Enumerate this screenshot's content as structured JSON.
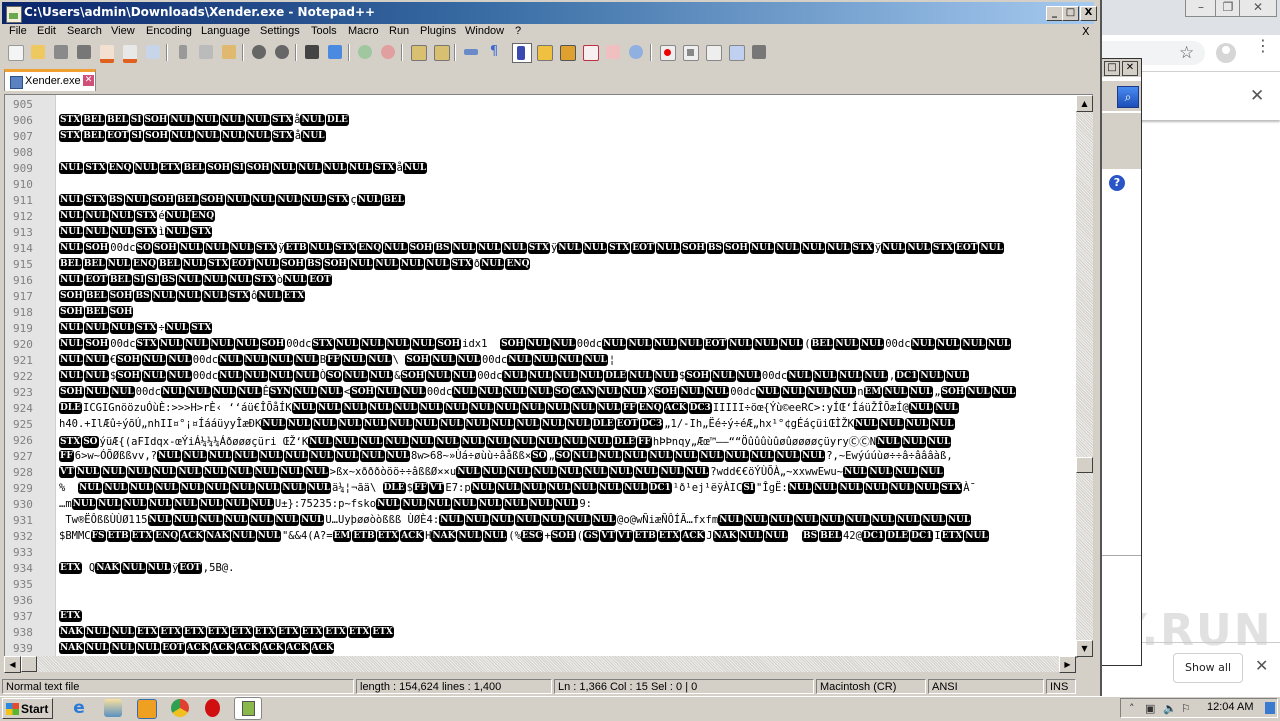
{
  "window": {
    "title": "C:\\Users\\admin\\Downloads\\Xender.exe - Notepad++",
    "minimize": "_",
    "maximize": "□",
    "close": "X"
  },
  "menu": [
    "File",
    "Edit",
    "Search",
    "View",
    "Encoding",
    "Language",
    "Settings",
    "Tools",
    "Macro",
    "Run",
    "Plugins",
    "Window",
    "?"
  ],
  "menu_close": "X",
  "toolbar": {
    "buttons": [
      "new-file",
      "open-file",
      "save",
      "save-all",
      "close",
      "close-all",
      "print",
      "cut",
      "copy",
      "paste",
      "undo",
      "redo",
      "find",
      "replace",
      "zoom-in",
      "zoom-out",
      "sync-vertical",
      "sync-horizontal",
      "word-wrap",
      "show-all-characters",
      "indent-guide",
      "user-defined-language",
      "document-map",
      "function-list",
      "folder-as-workspace",
      "monitoring",
      "start-recording",
      "stop-recording",
      "playback",
      "run-macro-multiple",
      "save-macro"
    ]
  },
  "tabs": [
    {
      "label": "Xender.exe",
      "active": true
    }
  ],
  "editor": {
    "lines": [
      {
        "n": "905",
        "t": []
      },
      {
        "n": "906",
        "t": [
          "@STX",
          "@BEL",
          "@BEL",
          "@SI",
          "@SOH",
          "@NUL",
          "@NUL",
          "@NUL",
          "@NUL",
          "@STX",
          "å",
          "@NUL",
          "@DLE"
        ]
      },
      {
        "n": "907",
        "t": [
          "@STX",
          "@BEL",
          "@EOT",
          "@SI",
          "@SOH",
          "@NUL",
          "@NUL",
          "@NUL",
          "@NUL",
          "@STX",
          "å",
          "@NUL"
        ]
      },
      {
        "n": "908",
        "t": []
      },
      {
        "n": "909",
        "t": [
          "@NUL",
          "@STX",
          "@ENQ",
          "@NUL",
          "@ETX",
          "@BEL",
          "@SOH",
          "@SI",
          "@SOH",
          "@NUL",
          "@NUL",
          "@NUL",
          "@NUL",
          "@STX",
          "å",
          "@NUL"
        ]
      },
      {
        "n": "910",
        "t": []
      },
      {
        "n": "911",
        "t": [
          "@NUL",
          "@STX",
          "@BS",
          "@NUL",
          "@SOH",
          "@BEL",
          "@SOH",
          "@NUL",
          "@NUL",
          "@NUL",
          "@NUL",
          "@STX",
          "ç",
          "@NUL",
          "@BEL"
        ]
      },
      {
        "n": "912",
        "t": [
          "@NUL",
          "@NUL",
          "@NUL",
          "@STX",
          "é",
          "@NUL",
          "@ENQ"
        ]
      },
      {
        "n": "913",
        "t": [
          "@NUL",
          "@NUL",
          "@NUL",
          "@STX",
          "ì",
          "@NUL",
          "@STX"
        ]
      },
      {
        "n": "914",
        "t": [
          "@NUL",
          "@SOH",
          "00dc",
          "@SO",
          "@SOH",
          "@NUL",
          "@NUL",
          "@NUL",
          "@STX",
          "ÿ",
          "@ETB",
          "@NUL",
          "@STX",
          "@ENQ",
          "@NUL",
          "@SOH",
          "@BS",
          "@NUL",
          "@NUL",
          "@NUL",
          "@STX",
          "ÿ",
          "@NUL",
          "@NUL",
          "@STX",
          "@EOT",
          "@NUL",
          "@SOH",
          "@BS",
          "@SOH",
          "@NUL",
          "@NUL",
          "@NUL",
          "@NUL",
          "@STX",
          "ÿ",
          "@NUL",
          "@NUL",
          "@STX",
          "@EOT",
          "@NUL"
        ]
      },
      {
        "n": "915",
        "t": [
          "@BEL",
          "@BEL",
          "@NUL",
          "@ENQ",
          "@BEL",
          "@NUL",
          "@STX",
          "@EOT",
          "@NUL",
          "@SOH",
          "@BS",
          "@SOH",
          "@NUL",
          "@NUL",
          "@NUL",
          "@NUL",
          "@STX",
          "ð",
          "@NUL",
          "@ENQ"
        ]
      },
      {
        "n": "916",
        "t": [
          "@NUL",
          "@EOT",
          "@BEL",
          "@SI",
          "@SI",
          "@BS",
          "@NUL",
          "@NUL",
          "@NUL",
          "@STX",
          "ò",
          "@NUL",
          "@EOT"
        ]
      },
      {
        "n": "917",
        "t": [
          "@SOH",
          "@BEL",
          "@SOH",
          "@BS",
          "@NUL",
          "@NUL",
          "@NUL",
          "@STX",
          "ô",
          "@NUL",
          "@ETX"
        ]
      },
      {
        "n": "918",
        "t": [
          "@SOH",
          "@BEL",
          "@SOH"
        ]
      },
      {
        "n": "919",
        "t": [
          "@NUL",
          "@NUL",
          "@NUL",
          "@STX",
          "÷",
          "@NUL",
          "@STX"
        ]
      },
      {
        "n": "920",
        "t": [
          "@NUL",
          "@SOH",
          "00dc",
          "@STX",
          "@NUL",
          "@NUL",
          "@NUL",
          "@NUL",
          "@SOH",
          "00dc",
          "@STX",
          "@NUL",
          "@NUL",
          "@NUL",
          "@NUL",
          "@SOH",
          "idx1  ",
          "@SOH",
          "@NUL",
          "@NUL",
          "00dc",
          "@NUL",
          "@NUL",
          "@NUL",
          "@NUL",
          "@EOT",
          "@NUL",
          "@NUL",
          "@NUL",
          "(",
          "@BEL",
          "@NUL",
          "@NUL",
          "00dc",
          "@NUL",
          "@NUL",
          "@NUL",
          "@NUL"
        ]
      },
      {
        "n": "921",
        "t": [
          "@NUL",
          "@NUL",
          "€",
          "@SOH",
          "@NUL",
          "@NUL",
          "00dc",
          "@NUL",
          "@NUL",
          "@NUL",
          "@NUL",
          "B",
          "@FF",
          "@NUL",
          "@NUL",
          "\\ ",
          "@SOH",
          "@NUL",
          "@NUL",
          "00dc",
          "@NUL",
          "@NUL",
          "@NUL",
          "@NUL",
          "¦"
        ]
      },
      {
        "n": "922",
        "t": [
          "@NUL",
          "@NUL",
          "$",
          "@SOH",
          "@NUL",
          "@NUL",
          "00dc",
          "@NUL",
          "@NUL",
          "@NUL",
          "@NUL",
          "Ò",
          "@SO",
          "@NUL",
          "@NUL",
          "&",
          "@SOH",
          "@NUL",
          "@NUL",
          "00dc",
          "@NUL",
          "@NUL",
          "@NUL",
          "@NUL",
          "@DLE",
          "@NUL",
          "@NUL",
          "$",
          "@SOH",
          "@NUL",
          "@NUL",
          "00dc",
          "@NUL",
          "@NUL",
          "@NUL",
          "@NUL",
          ",",
          "@DC1",
          "@NUL",
          "@NUL"
        ]
      },
      {
        "n": "923",
        "t": [
          "@SOH",
          "@NUL",
          "@NUL",
          "00dc",
          "@NUL",
          "@NUL",
          "@NUL",
          "@NUL",
          "Ê",
          "@SYN",
          "@NUL",
          "@NUL",
          "<",
          "@SOH",
          "@NUL",
          "@NUL",
          "00dc",
          "@NUL",
          "@NUL",
          "@NUL",
          "@NUL",
          "@SO",
          "@CAN",
          "@NUL",
          "@NUL",
          "X",
          "@SOH",
          "@NUL",
          "@NUL",
          "00dc",
          "@NUL",
          "@NUL",
          "@NUL",
          "@NUL",
          "n",
          "@EM",
          "@NUL",
          "@NUL",
          "„",
          "@SOH",
          "@NUL",
          "@NUL"
        ]
      },
      {
        "n": "924",
        "t": [
          "@DLE",
          "ICGIGnöözuÓùÈ:>>>H>rÈ‹ ‘‘áü€ÎÕåÍK",
          "@NUL",
          "@NUL",
          "@NUL",
          "@NUL",
          "@NUL",
          "@NUL",
          "@NUL",
          "@NUL",
          "@NUL",
          "@NUL",
          "@NUL",
          "@NUL",
          "@NUL",
          "@FF",
          "@ENQ",
          "@ACK",
          "@DC3",
          "IIIII÷öœ{Ýù©eeRC>:yÍŒ‘ÍáüŽÎÕæÍ@",
          "@NUL",
          "@NUL"
        ]
      },
      {
        "n": "925",
        "t": [
          "h40.+Il\u0007Æû÷ýõÚ„nhII¤°¡¤ÍááüyyÎæÐK",
          "@NUL",
          "@NUL",
          "@NUL",
          "@NUL",
          "@NUL",
          "@NUL",
          "@NUL",
          "@NUL",
          "@NUL",
          "@NUL",
          "@NUL",
          "@NUL",
          "@NUL",
          "@DLE",
          "@EOT",
          "@DC3",
          "„1/-Ih\u0007„Ëé÷ý÷éÆ„\u0007hx¹°¢gÉáçü\u0007iŒÌŽK",
          "@NUL",
          "@NUL",
          "@NUL",
          "@NUL"
        ]
      },
      {
        "n": "926",
        "t": [
          "@STX",
          "@SO",
          "ýüÆ{(aFIdqx-œÝiÁ¼¼¼Áðøøøçüri ŒŽ‘K",
          "@NUL",
          "@NUL",
          "@NUL",
          "@NUL",
          "@NUL",
          "@NUL",
          "@NUL",
          "@NUL",
          "@NUL",
          "@NUL",
          "@NUL",
          "@NUL",
          "@DLE",
          "@FF",
          "hÞÞnqy„Æœ™——““ÖûûûùûøûøøøøçüyryⒸⒸN",
          "@NUL",
          "@NUL",
          "@NUL"
        ]
      },
      {
        "n": "927",
        "t": [
          "@FF",
          "6>w~ÓÕØßßvv,?",
          "@NUL",
          "@NUL",
          "@NUL",
          "@NUL",
          "@NUL",
          "@NUL",
          "@NUL",
          "@NUL",
          "@NUL",
          "@NUL",
          "8w>68~»Ùá÷øùù÷âåßß×",
          "@SO",
          "„",
          "@SO",
          "@NUL",
          "@NUL",
          "@NUL",
          "@NUL",
          "@NUL",
          "@NUL",
          "@NUL",
          "@NUL",
          "@NUL",
          "@NUL",
          "?,~Ewýúúùø÷÷â÷âââàß,"
        ]
      },
      {
        "n": "928",
        "t": [
          "@VT",
          "@NUL",
          "@NUL",
          "@NUL",
          "@NUL",
          "@NUL",
          "@NUL",
          "@NUL",
          "@NUL",
          "@NUL",
          "@NUL",
          ">ßx~xðððòöö÷÷âßßØ××u",
          "@NUL",
          "@NUL",
          "@NUL",
          "@NUL",
          "@NUL",
          "@NUL",
          "@NUL",
          "@NUL",
          "@NUL",
          "@NUL",
          "?wdd€€öÝÙÕÀ„~xxwwEwu~",
          "@NUL",
          "@NUL",
          "@NUL",
          "@NUL"
        ]
      },
      {
        "n": "929",
        "t": [
          "%  ",
          "@NUL",
          "@NUL",
          "@NUL",
          "@NUL",
          "@NUL",
          "@NUL",
          "@NUL",
          "@NUL",
          "@NUL",
          "@NUL",
          "ä¼¦¬ãä\\ ",
          "@DLE",
          "$",
          "@FF",
          "@VT",
          "E7:p",
          "@NUL",
          "@NUL",
          "@NUL",
          "@NUL",
          "@NUL",
          "@NUL",
          "@NUL",
          "@DC1",
          "¹ð¹ej¹ëÿÀIC",
          "@SI",
          "\"ÎgË:",
          "@NUL",
          "@NUL",
          "@NUL",
          "@NUL",
          "@NUL",
          "@NUL",
          "@STX",
          "À¯"
        ]
      },
      {
        "n": "930",
        "t": [
          "…m",
          "@NUL",
          "@NUL",
          "@NUL",
          "@NUL",
          "@NUL",
          "@NUL",
          "@NUL",
          "@NUL",
          "U±}:75235:p~fsko",
          "@NUL",
          "@NUL",
          "@NUL",
          "@NUL",
          "@NUL",
          "@NUL",
          "@NUL",
          "@NUL",
          "9:"
        ]
      },
      {
        "n": "931",
        "t": [
          " Tw®ËÔßßÙÙØ115",
          "@NUL",
          "@NUL",
          "@NUL",
          "@NUL",
          "@NUL",
          "@NUL",
          "@NUL",
          "U…Uyþøøòòßßß ÙØÈ4:",
          "@NUL",
          "@NUL",
          "@NUL",
          "@NUL",
          "@NUL",
          "@NUL",
          "@NUL",
          "@o@wÑiæÑÔÍÃ…fxfm",
          "@NUL",
          "@NUL",
          "@NUL",
          "@NUL",
          "@NUL",
          "@NUL",
          "@NUL",
          "@NUL",
          "@NUL",
          "@NUL"
        ]
      },
      {
        "n": "932",
        "t": [
          "$BMMC",
          "@FS",
          "@ETB",
          "@ETX",
          "@ENQ",
          "@ACK",
          "@NAK",
          "@NUL",
          "@NUL",
          "\"&&4(A?=",
          "@EM",
          "@ETB",
          "@ETX",
          "@ACK",
          "H",
          "@NAK",
          "@NUL",
          "@NUL",
          "(%",
          "@ESC",
          "+",
          "@SOH",
          "(",
          "@GS",
          "@VT",
          "@VT",
          "@ETB",
          "@ETX",
          "@ACK",
          "J",
          "@NAK",
          "@NUL",
          "@NUL",
          "  ",
          "@BS",
          "@BEL",
          "42@",
          "@DC1",
          "@DLE",
          "@DC1",
          "I",
          "@ETX",
          "@NUL"
        ]
      },
      {
        "n": "933",
        "t": []
      },
      {
        "n": "934",
        "t": [
          "@ETX",
          " Q",
          "@NAK",
          "@NUL",
          "@NUL",
          "ÿ",
          "@EOT",
          ",5B@."
        ]
      },
      {
        "n": "935",
        "t": []
      },
      {
        "n": "936",
        "t": []
      },
      {
        "n": "937",
        "t": [
          "@ETX"
        ]
      },
      {
        "n": "938",
        "t": [
          "@NAK",
          "@NUL",
          "@NUL",
          "@ETX",
          "@ETX",
          "@ETX",
          "@ETX",
          "@ETX",
          "@ETX",
          "@ETX",
          "@ETX",
          "@ETX",
          "@ETX",
          "@ETX"
        ]
      },
      {
        "n": "939",
        "t": [
          "@NAK",
          "@NUL",
          "@NUL",
          "@NUL",
          "@EOT",
          "@ACK",
          "@ACK",
          "@ACK",
          "@ACK",
          "@ACK",
          "@ACK"
        ]
      }
    ],
    "vertical_scroll_fraction": 0.67
  },
  "statusbar": {
    "file_type": "Normal text file",
    "length_lines": "length : 154,624    lines : 1,400",
    "position": "Ln : 1,366    Col : 15    Sel : 0 | 0",
    "eol": "Macintosh (CR)",
    "encoding": "ANSI",
    "mode": "INS"
  },
  "browser": {
    "show_all": "Show all",
    "close": "✕",
    "star": "☆",
    "menu": "⋮",
    "watermark": "ANY.RUN"
  },
  "taskbar": {
    "start": "Start",
    "quicklaunch": [
      "internet-explorer",
      "file-explorer",
      "media-player",
      "chrome",
      "opera",
      "notepad-plus-plus"
    ],
    "clock": "12:04 AM"
  },
  "colors": {
    "titlebar_start": "#0a246a",
    "titlebar_end": "#a6caf0",
    "control_char_bg": "#000000",
    "gutter": "#e4e4e4",
    "tab_accent": "#f0a030"
  }
}
